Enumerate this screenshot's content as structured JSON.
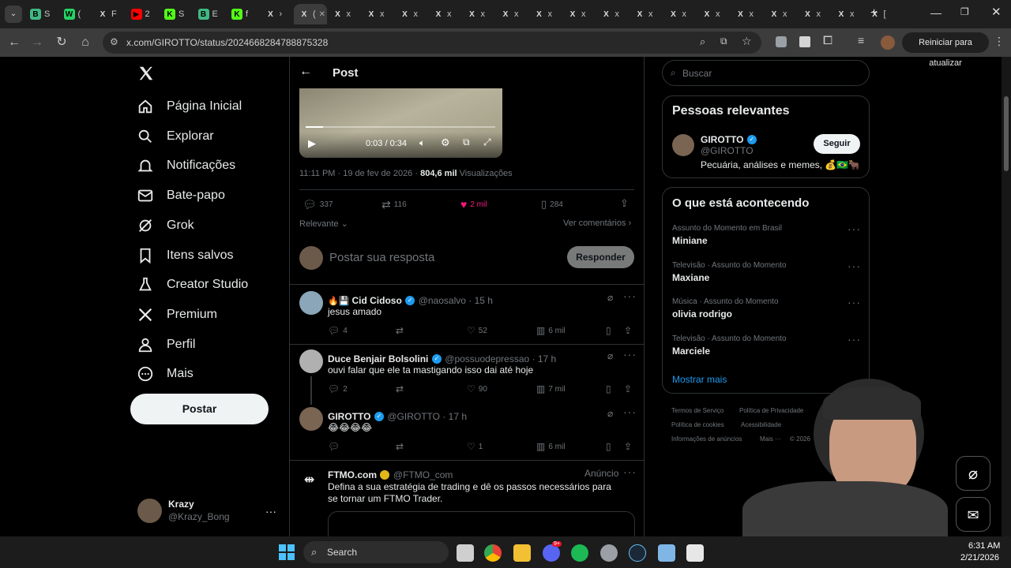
{
  "browser": {
    "tabs": [
      {
        "label": "S",
        "fav": "B",
        "color": "#41b883"
      },
      {
        "label": "(",
        "fav": "W",
        "color": "#25d366"
      },
      {
        "label": "F",
        "fav": "X",
        "color": "#000000"
      },
      {
        "label": "2",
        "fav": "▶",
        "color": "#ff0000"
      },
      {
        "label": "S",
        "fav": "K",
        "color": "#53fc18"
      },
      {
        "label": "E",
        "fav": "B",
        "color": "#41b883"
      },
      {
        "label": "f",
        "fav": "K",
        "color": "#53fc18"
      },
      {
        "label": "›",
        "fav": "X",
        "color": "#000000"
      },
      {
        "label": "(",
        "fav": "X",
        "color": "#000000"
      },
      {
        "label": "x",
        "fav": "X",
        "color": "#000000"
      },
      {
        "label": "x",
        "fav": "X",
        "color": "#000000"
      },
      {
        "label": "x",
        "fav": "X",
        "color": "#000000"
      },
      {
        "label": "x",
        "fav": "X",
        "color": "#000000"
      },
      {
        "label": "x",
        "fav": "X",
        "color": "#000000"
      },
      {
        "label": "x",
        "fav": "X",
        "color": "#000000"
      },
      {
        "label": "x",
        "fav": "X",
        "color": "#000000"
      },
      {
        "label": "x",
        "fav": "X",
        "color": "#000000"
      },
      {
        "label": "x",
        "fav": "X",
        "color": "#000000"
      },
      {
        "label": "x",
        "fav": "X",
        "color": "#000000"
      },
      {
        "label": "x",
        "fav": "X",
        "color": "#000000"
      },
      {
        "label": "x",
        "fav": "X",
        "color": "#000000"
      },
      {
        "label": "x",
        "fav": "X",
        "color": "#000000"
      },
      {
        "label": "x",
        "fav": "X",
        "color": "#000000"
      },
      {
        "label": "x",
        "fav": "X",
        "color": "#000000"
      },
      {
        "label": "x",
        "fav": "X",
        "color": "#000000"
      },
      {
        "label": "[",
        "fav": "X",
        "color": "#000000"
      }
    ],
    "new_tab": "+",
    "url": "x.com/GIROTTO/status/2024668284788875328",
    "update_button": "Reiniciar para atualizar"
  },
  "nav": {
    "items": [
      {
        "label": "Página Inicial",
        "icon": "home-icon"
      },
      {
        "label": "Explorar",
        "icon": "search-icon"
      },
      {
        "label": "Notificações",
        "icon": "bell-icon"
      },
      {
        "label": "Bate-papo",
        "icon": "mail-icon"
      },
      {
        "label": "Grok",
        "icon": "grok-icon"
      },
      {
        "label": "Itens salvos",
        "icon": "bookmark-icon"
      },
      {
        "label": "Creator Studio",
        "icon": "flask-icon"
      },
      {
        "label": "Premium",
        "icon": "x-logo-icon"
      },
      {
        "label": "Perfil",
        "icon": "user-icon"
      },
      {
        "label": "Mais",
        "icon": "more-circle-icon"
      }
    ],
    "post_button": "Postar",
    "account": {
      "name": "Krazy",
      "handle": "@Krazy_Bong",
      "menu": "···"
    }
  },
  "post": {
    "header_title": "Post",
    "video_time": "0:03 / 0:34",
    "timestamp": "11:11 PM · 19 de fev de 2026 · ",
    "views_count": "804,6 mil",
    "views_label": " Visualizações",
    "replies": "337",
    "reposts": "116",
    "likes": "2 mil",
    "bookmarks": "284",
    "sort_label": "Relevante",
    "view_comments": "Ver comentários",
    "reply_placeholder": "Postar sua resposta",
    "reply_button": "Responder"
  },
  "replies": [
    {
      "prefix": "🔥💾 ",
      "name": "Cid Cidoso",
      "handle": "@naosalvo · 15 h",
      "text": "jesus amado",
      "replies": "4",
      "reposts": "",
      "likes": "52",
      "views": "6 mil"
    },
    {
      "prefix": "",
      "name": "Duce Benjair Bolsolini",
      "handle": "@possuodepressao · 17 h",
      "text": "ouvi falar que ele ta mastigando isso dai até hoje",
      "replies": "2",
      "reposts": "",
      "likes": "90",
      "views": "7 mil"
    },
    {
      "prefix": "",
      "name": "GIROTTO",
      "handle": "@GIROTTO · 17 h",
      "text": "😂😂😂😂",
      "replies": "",
      "reposts": "",
      "likes": "1",
      "views": "6 mil"
    }
  ],
  "ad": {
    "name": "FTMO.com",
    "handle": "@FTMO_com",
    "badge": "Anúncio",
    "text": "Defina a sua estratégia de trading e dê os passos necessários para se tornar um FTMO Trader."
  },
  "sidebar": {
    "search_placeholder": "Buscar",
    "relevant_title": "Pessoas relevantes",
    "relevant_person": {
      "name": "GIROTTO",
      "handle": "@GIROTTO",
      "bio": "Pecuária, análises e memes, 💰🇧🇷🐂",
      "follow": "Seguir"
    },
    "trends_title": "O que está acontecendo",
    "trends": [
      {
        "meta": "Assunto do Momento em Brasil",
        "name": "Miniane"
      },
      {
        "meta": "Televisão · Assunto do Momento",
        "name": "Maxiane"
      },
      {
        "meta": "Música · Assunto do Momento",
        "name": "olivia rodrigo"
      },
      {
        "meta": "Televisão · Assunto do Momento",
        "name": "Marciele"
      }
    ],
    "show_more": "Mostrar mais",
    "footer": [
      "Termos de Serviço",
      "Política de Privacidade",
      "Política de cookies",
      "Acessibilidade",
      "Informações de anúncios",
      "Mais ···",
      "© 2026"
    ]
  },
  "taskbar": {
    "search": "Search",
    "time": "6:31 AM",
    "date": "2/21/2026",
    "discord_badge": "9+"
  },
  "colors": {
    "accent": "#1d9bf0",
    "like": "#f91880",
    "bg": "#000000"
  }
}
